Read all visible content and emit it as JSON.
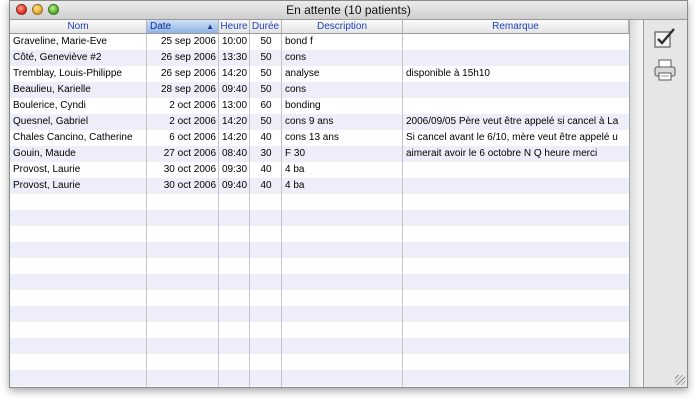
{
  "window": {
    "title": "En attente (10 patients)"
  },
  "columns": [
    {
      "key": "nom",
      "label": "Nom"
    },
    {
      "key": "date",
      "label": "Date"
    },
    {
      "key": "heure",
      "label": "Heure"
    },
    {
      "key": "duree",
      "label": "Durée"
    },
    {
      "key": "description",
      "label": "Description"
    },
    {
      "key": "remarque",
      "label": "Remarque"
    }
  ],
  "sort": {
    "column": "date",
    "direction": "ascending"
  },
  "rows": [
    {
      "nom": "Graveline, Marie-Eve",
      "date": "25 sep 2006",
      "heure": "10:00",
      "duree": "50",
      "description": "bond f",
      "remarque": ""
    },
    {
      "nom": "Côté, Geneviève #2",
      "date": "26 sep 2006",
      "heure": "13:30",
      "duree": "50",
      "description": "cons",
      "remarque": ""
    },
    {
      "nom": "Tremblay, Louis-Philippe",
      "date": "26 sep 2006",
      "heure": "14:20",
      "duree": "50",
      "description": "analyse",
      "remarque": "disponible à 15h10"
    },
    {
      "nom": "Beaulieu, Karielle",
      "date": "28 sep 2006",
      "heure": "09:40",
      "duree": "50",
      "description": "cons",
      "remarque": ""
    },
    {
      "nom": "Boulerice, Cyndi",
      "date": "2 oct 2006",
      "heure": "13:00",
      "duree": "60",
      "description": "bonding",
      "remarque": ""
    },
    {
      "nom": "Quesnel, Gabriel",
      "date": "2 oct 2006",
      "heure": "14:20",
      "duree": "50",
      "description": "cons 9 ans",
      "remarque": "2006/09/05 Père veut être appelé si cancel à La"
    },
    {
      "nom": "Chales Cancino, Catherine",
      "date": "6 oct 2006",
      "heure": "14:20",
      "duree": "40",
      "description": "cons 13 ans",
      "remarque": "Si cancel avant le 6/10, mère veut être appelé u"
    },
    {
      "nom": "Gouin, Maude",
      "date": "27 oct 2006",
      "heure": "08:40",
      "duree": "30",
      "description": "F 30",
      "remarque": "aimerait avoir le 6 octobre N Q heure merci"
    },
    {
      "nom": "Provost, Laurie",
      "date": "30 oct 2006",
      "heure": "09:30",
      "duree": "40",
      "description": "4 ba",
      "remarque": ""
    },
    {
      "nom": "Provost, Laurie",
      "date": "30 oct 2006",
      "heure": "09:40",
      "duree": "40",
      "description": "4 ba",
      "remarque": ""
    }
  ],
  "toolbar": [
    {
      "name": "checklist-icon"
    },
    {
      "name": "printer-icon"
    }
  ],
  "colors": {
    "stripe": "#eceffa",
    "header_text": "#1c3fbf",
    "sorted_header": "#8fb4e6"
  }
}
